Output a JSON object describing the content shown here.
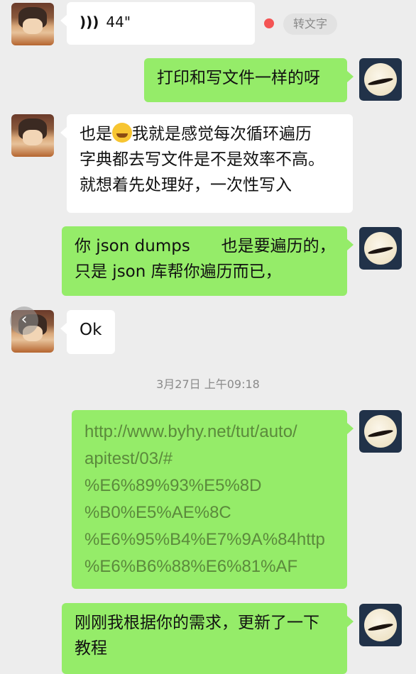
{
  "chat": {
    "voice": {
      "duration": "44\"",
      "transcribe_label": "转文字"
    },
    "msg1": {
      "lines": [
        "打印和写文件一样的呀"
      ]
    },
    "msg2": {
      "line1_pre": "也是",
      "line1_post": "我就是感觉每次循环遍历",
      "line2": "字典都去写文件是不是效率不高。",
      "line3": "就想着先处理好，一次性写入"
    },
    "msg3": {
      "line1": "你 json dumps      也是要遍历的，",
      "line2": "只是 json 库帮你遍历而已，"
    },
    "msg4": {
      "text": "Ok"
    },
    "timestamp": "3月27日 上午09:18",
    "msg5": {
      "url_lines": [
        "http://www.byhy.net/tut/auto/",
        "apitest/03/#",
        "%E6%89%93%E5%8D",
        "%B0%E5%AE%8C",
        "%E6%95%B4%E7%9A%84http",
        "%E6%B6%88%E6%81%AF"
      ]
    },
    "msg6": {
      "line1": "刚刚我根据你的需求，更新了一下",
      "line2": "教程"
    }
  },
  "icons": {
    "voice": "voice-wave-icon",
    "emoji": "sweat-smile-emoji-icon",
    "back": "chevron-left-icon"
  },
  "colors": {
    "outgoing_bubble": "#95ec69",
    "incoming_bubble": "#ffffff",
    "background": "#ededed",
    "link": "#5b8a3c",
    "unread_dot": "#f45454"
  }
}
